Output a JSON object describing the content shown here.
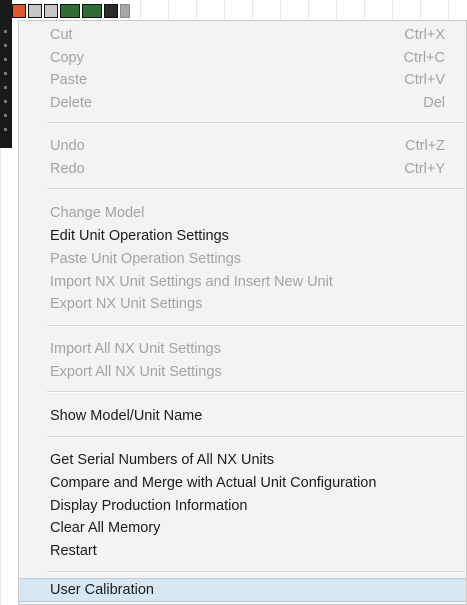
{
  "context_menu": {
    "items": [
      {
        "label": "Cut",
        "shortcut": "Ctrl+X",
        "enabled": false
      },
      {
        "label": "Copy",
        "shortcut": "Ctrl+C",
        "enabled": false
      },
      {
        "label": "Paste",
        "shortcut": "Ctrl+V",
        "enabled": false
      },
      {
        "label": "Delete",
        "shortcut": "Del",
        "enabled": false
      },
      {
        "label": "Undo",
        "shortcut": "Ctrl+Z",
        "enabled": false
      },
      {
        "label": "Redo",
        "shortcut": "Ctrl+Y",
        "enabled": false
      },
      {
        "label": "Change Model",
        "enabled": false
      },
      {
        "label": "Edit Unit Operation Settings",
        "enabled": true
      },
      {
        "label": "Paste Unit Operation Settings",
        "enabled": false
      },
      {
        "label": "Import NX Unit Settings and Insert New Unit",
        "enabled": false
      },
      {
        "label": "Export NX Unit Settings",
        "enabled": false
      },
      {
        "label": "Import All NX Unit Settings",
        "enabled": false
      },
      {
        "label": "Export All NX Unit Settings",
        "enabled": false
      },
      {
        "label": "Show Model/Unit Name",
        "enabled": true
      },
      {
        "label": "Get Serial Numbers of All NX Units",
        "enabled": true
      },
      {
        "label": "Compare and Merge with Actual Unit Configuration",
        "enabled": true
      },
      {
        "label": "Display Production Information",
        "enabled": true
      },
      {
        "label": "Clear All Memory",
        "enabled": true
      },
      {
        "label": "Restart",
        "enabled": true
      },
      {
        "label": "User Calibration",
        "enabled": true,
        "highlighted": true
      }
    ]
  },
  "colors": {
    "menu_background": "#f3f3f3",
    "enabled_text": "#1c1c1c",
    "disabled_text": "#a3a3a3",
    "highlight": "#d8e6f2",
    "separator": "#d4d4d4"
  }
}
